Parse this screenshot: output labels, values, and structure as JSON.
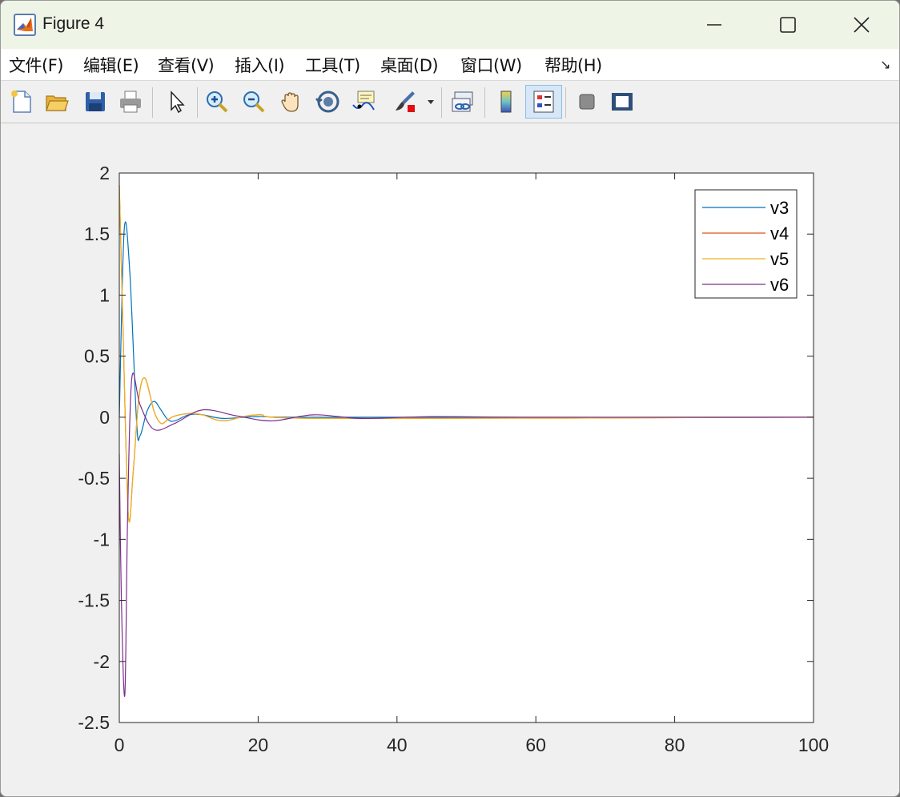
{
  "window": {
    "title": "Figure 4"
  },
  "menubar": {
    "items": [
      {
        "label": "文件(F)"
      },
      {
        "label": "编辑(E)"
      },
      {
        "label": "查看(V)"
      },
      {
        "label": "插入(I)"
      },
      {
        "label": "工具(T)"
      },
      {
        "label": "桌面(D)"
      },
      {
        "label": "窗口(W)"
      },
      {
        "label": "帮助(H)"
      }
    ]
  },
  "toolbar": {
    "buttons": [
      {
        "icon": "new-figure-icon"
      },
      {
        "icon": "open-file-icon"
      },
      {
        "icon": "save-icon"
      },
      {
        "icon": "print-icon"
      },
      {
        "icon": "pointer-icon"
      },
      {
        "icon": "zoom-in-icon"
      },
      {
        "icon": "zoom-out-icon"
      },
      {
        "icon": "pan-hand-icon"
      },
      {
        "icon": "rotate-3d-icon"
      },
      {
        "icon": "data-cursor-icon"
      },
      {
        "icon": "brush-icon"
      },
      {
        "icon": "link-plot-icon"
      },
      {
        "icon": "colorbar-icon"
      },
      {
        "icon": "legend-icon"
      },
      {
        "icon": "hide-plot-tools-icon"
      },
      {
        "icon": "show-plot-tools-icon"
      }
    ]
  },
  "colors": {
    "v3": "#0072BD",
    "v4": "#D95319",
    "v5": "#EDB120",
    "v6": "#7E2F8E",
    "titlebar": "#eef5e6"
  },
  "chart_data": {
    "type": "line",
    "title": "",
    "xlabel": "",
    "ylabel": "",
    "xlim": [
      0,
      100
    ],
    "ylim": [
      -2.5,
      2
    ],
    "xticks": [
      "0",
      "20",
      "40",
      "60",
      "80",
      "100"
    ],
    "yticks": [
      "2",
      "1.5",
      "1",
      "0.5",
      "0",
      "-0.5",
      "-1",
      "-1.5",
      "-2",
      "-2.5"
    ],
    "grid": false,
    "legend_position": "top-right",
    "series": [
      {
        "name": "v3",
        "x": [
          0,
          0.7,
          1.5,
          2.5,
          3,
          4,
          5,
          6,
          7,
          8,
          10,
          12,
          15,
          20,
          30,
          100
        ],
        "y": [
          0,
          1.53,
          1.2,
          -0.05,
          -0.15,
          0.05,
          0.13,
          0.06,
          -0.02,
          -0.03,
          0.02,
          0.02,
          -0.01,
          0.005,
          0,
          0
        ]
      },
      {
        "name": "v4",
        "x": [
          0,
          0.5,
          1.3,
          2,
          2.8,
          3.7,
          5,
          6,
          7,
          8,
          10,
          12,
          15,
          20,
          30,
          100
        ],
        "y": [
          1.9,
          0.8,
          -0.8,
          -0.45,
          0.15,
          0.32,
          0.05,
          -0.05,
          -0.02,
          0.01,
          0.03,
          0.02,
          -0.03,
          0.02,
          -0.01,
          0
        ]
      },
      {
        "name": "v5",
        "x": [
          0,
          0.5,
          1.3,
          2,
          2.8,
          3.7,
          5,
          6,
          7,
          8,
          10,
          12,
          15,
          20,
          30,
          100
        ],
        "y": [
          1.9,
          0.8,
          -0.8,
          -0.45,
          0.15,
          0.32,
          0.05,
          -0.05,
          -0.02,
          0.01,
          0.03,
          0.02,
          -0.03,
          0.02,
          -0.01,
          0
        ]
      },
      {
        "name": "v6",
        "x": [
          0,
          0.3,
          0.8,
          1.2,
          1.8,
          3,
          5,
          8,
          12,
          17,
          22,
          28,
          35,
          45,
          60,
          100
        ],
        "y": [
          -0.3,
          -1.5,
          -2.27,
          -0.8,
          0.32,
          0.1,
          -0.1,
          -0.05,
          0.06,
          0.01,
          -0.03,
          0.02,
          -0.01,
          0.005,
          0,
          0
        ]
      }
    ]
  }
}
